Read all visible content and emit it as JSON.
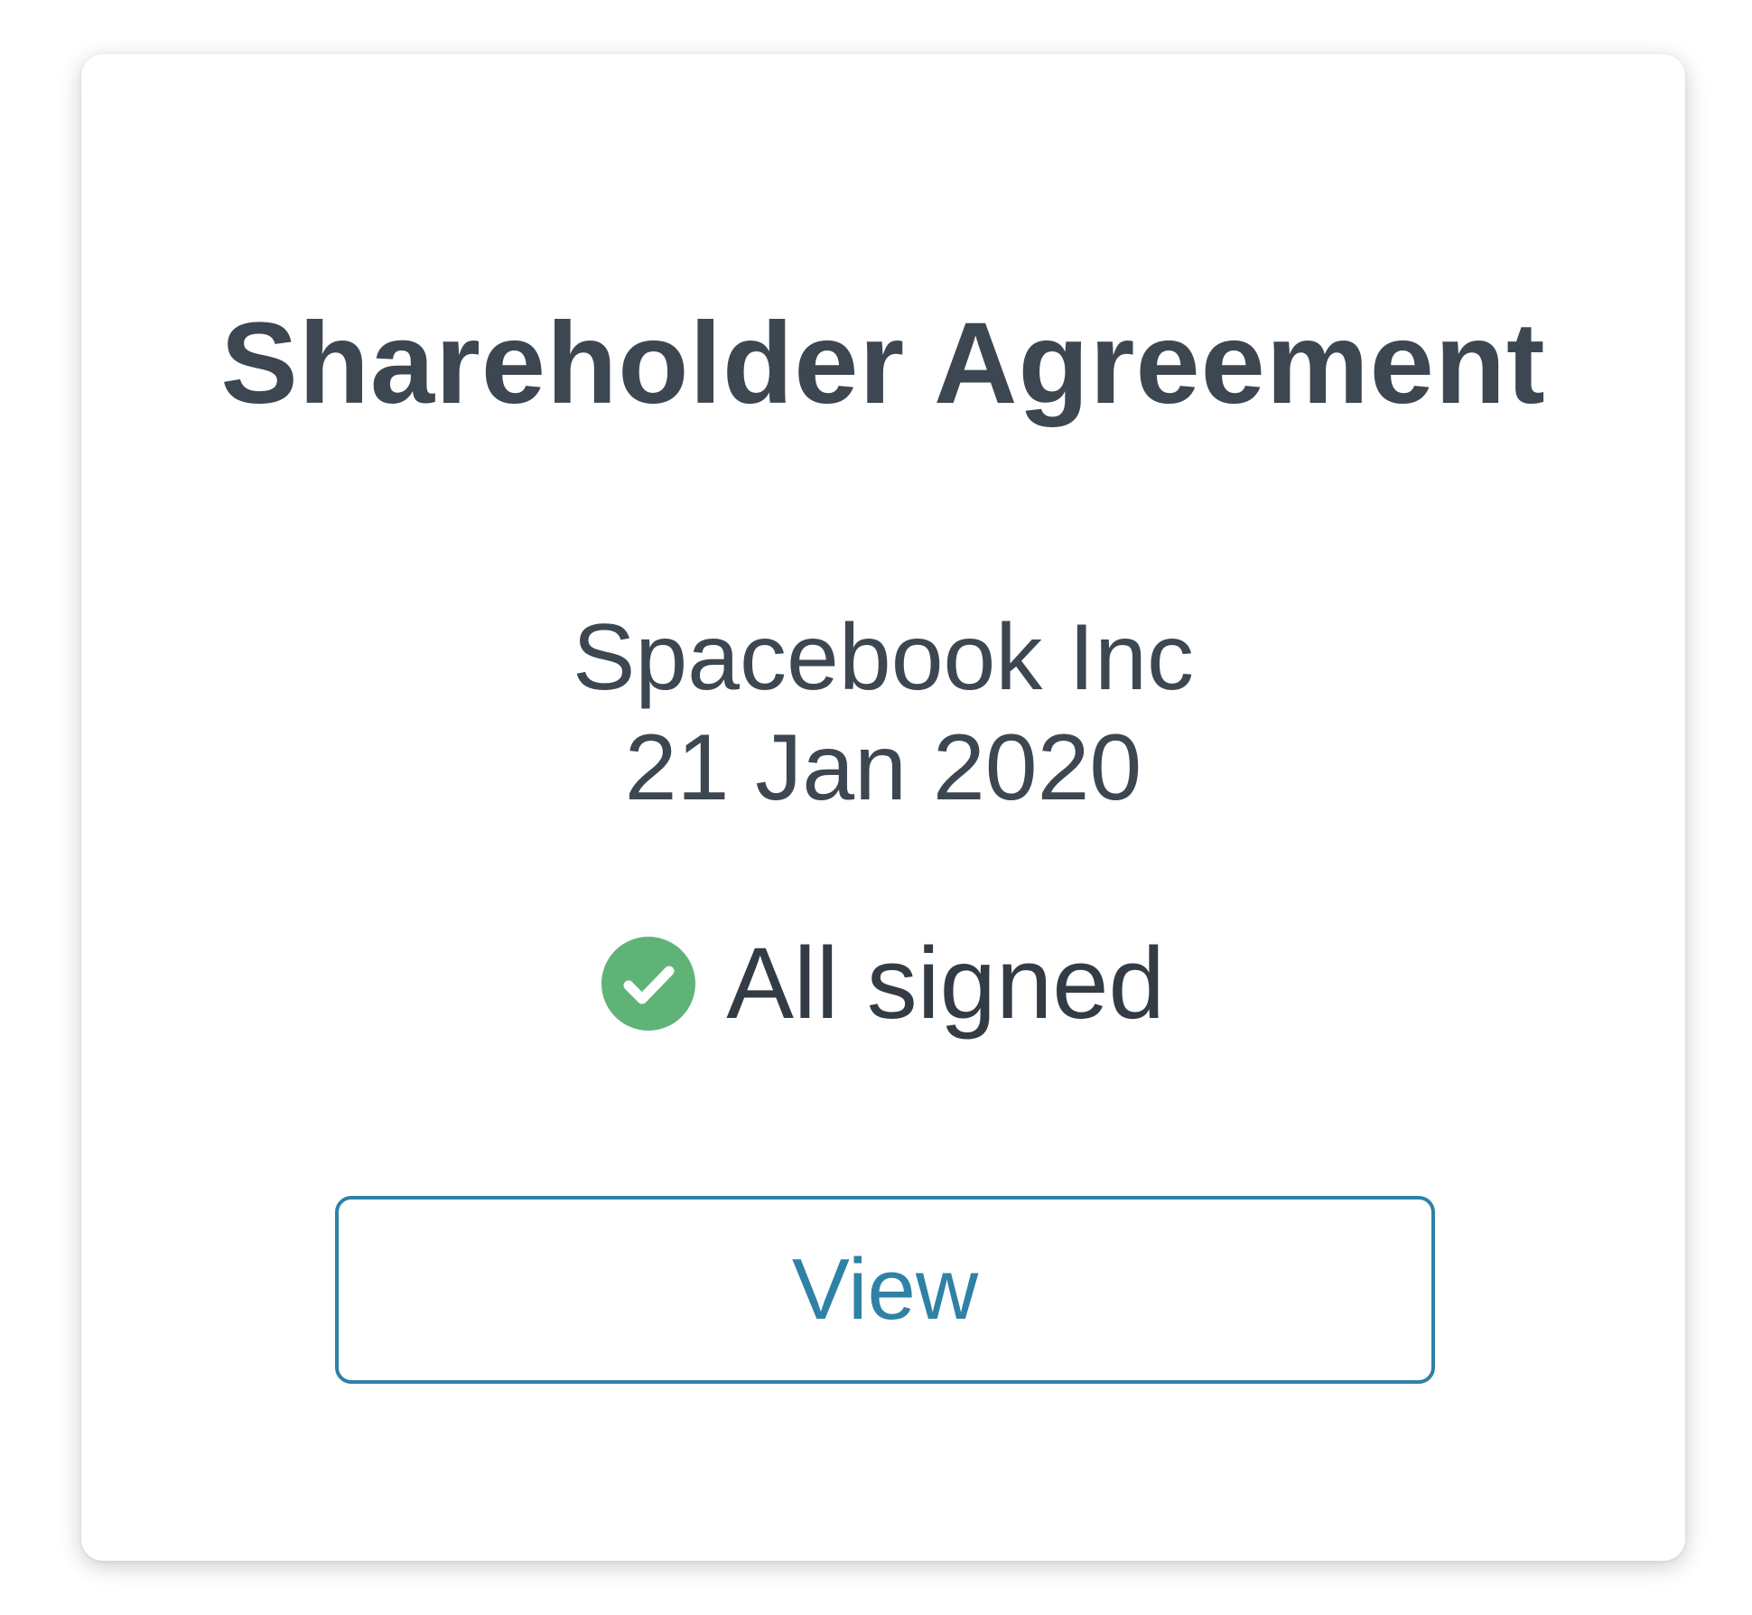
{
  "card": {
    "title": "Shareholder Agreement",
    "company": "Spacebook Inc",
    "date": "21 Jan 2020",
    "status": {
      "label": "All signed",
      "icon": "check-circle-icon",
      "color": "#5fb376"
    },
    "view_button_label": "View",
    "accent_color": "#2f81a6"
  }
}
